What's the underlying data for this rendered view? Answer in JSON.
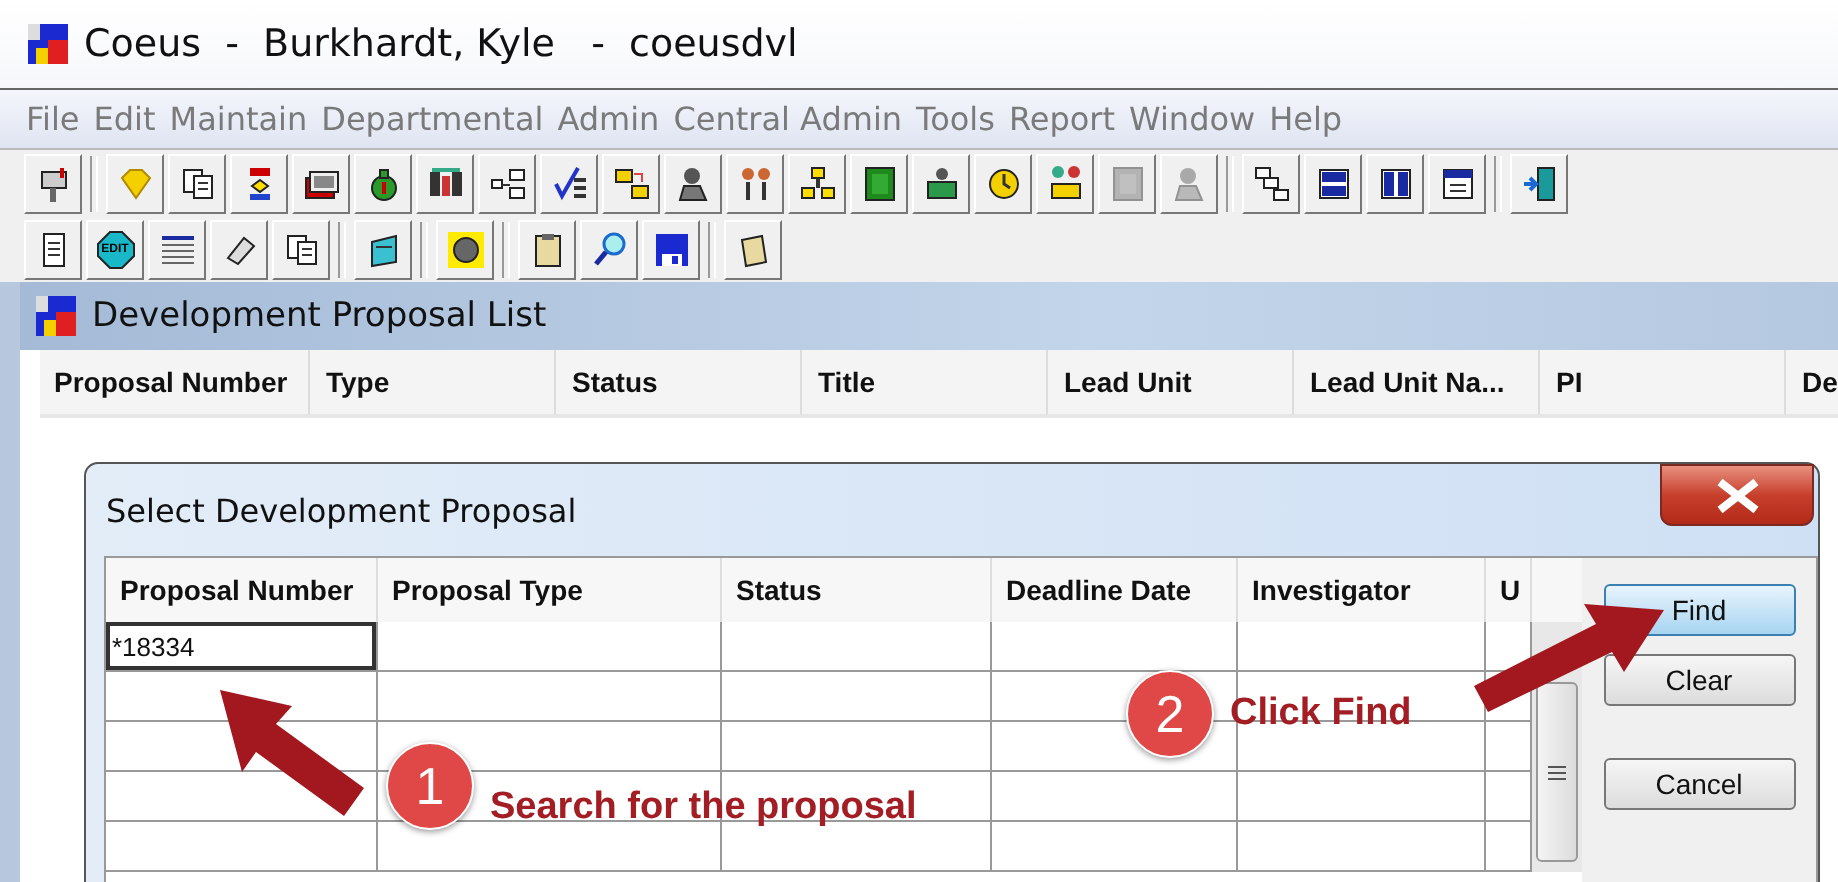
{
  "window": {
    "title": "Coeus  -  Burkhardt, Kyle   -  coeusdvl"
  },
  "menu": [
    "File",
    "Edit",
    "Maintain",
    "Departmental",
    "Admin",
    "Central Admin",
    "Tools",
    "Report",
    "Window",
    "Help"
  ],
  "toolbar_1": [
    {
      "kind": "button",
      "disabled": false
    },
    {
      "kind": "separator"
    },
    {
      "kind": "button",
      "disabled": false
    },
    {
      "kind": "button",
      "disabled": false
    },
    {
      "kind": "button",
      "disabled": false
    },
    {
      "kind": "button",
      "disabled": false
    },
    {
      "kind": "button",
      "disabled": false
    },
    {
      "kind": "button",
      "disabled": false
    },
    {
      "kind": "button",
      "disabled": false
    },
    {
      "kind": "button",
      "disabled": false
    },
    {
      "kind": "button",
      "disabled": false
    },
    {
      "kind": "button",
      "disabled": false
    },
    {
      "kind": "button",
      "disabled": false
    },
    {
      "kind": "button",
      "disabled": false
    },
    {
      "kind": "button",
      "disabled": false
    },
    {
      "kind": "button",
      "disabled": false
    },
    {
      "kind": "button",
      "disabled": false
    },
    {
      "kind": "button",
      "disabled": false
    },
    {
      "kind": "button",
      "disabled": true
    },
    {
      "kind": "button",
      "disabled": true
    },
    {
      "kind": "separator"
    },
    {
      "kind": "button",
      "disabled": false
    },
    {
      "kind": "button",
      "disabled": false
    },
    {
      "kind": "button",
      "disabled": false
    },
    {
      "kind": "button",
      "disabled": false
    },
    {
      "kind": "separator"
    },
    {
      "kind": "button",
      "disabled": false
    }
  ],
  "toolbar_2": [
    {
      "kind": "button",
      "disabled": false
    },
    {
      "kind": "button",
      "disabled": false,
      "label": "EDIT"
    },
    {
      "kind": "button",
      "disabled": false
    },
    {
      "kind": "button",
      "disabled": false
    },
    {
      "kind": "button",
      "disabled": false
    },
    {
      "kind": "separator"
    },
    {
      "kind": "button",
      "disabled": false
    },
    {
      "kind": "separator"
    },
    {
      "kind": "button",
      "disabled": false
    },
    {
      "kind": "separator"
    },
    {
      "kind": "button",
      "disabled": false
    },
    {
      "kind": "button",
      "disabled": false
    },
    {
      "kind": "button",
      "disabled": false
    },
    {
      "kind": "separator"
    },
    {
      "kind": "button",
      "disabled": false
    }
  ],
  "proposal_list": {
    "title": "Development Proposal List",
    "columns": [
      "Proposal Number",
      "Type",
      "Status",
      "Title",
      "Lead Unit",
      "Lead Unit Na...",
      "PI",
      "De"
    ]
  },
  "dialog": {
    "title": "Select Development Proposal",
    "columns": [
      "Proposal Number",
      "Proposal Type",
      "Status",
      "Deadline Date",
      "Investigator",
      "U"
    ],
    "search_value": "*18334",
    "buttons": [
      {
        "label": "Find",
        "default": true
      },
      {
        "label": "Clear",
        "default": false
      },
      {
        "label": "Cancel",
        "default": false
      }
    ]
  },
  "annotations": [
    {
      "number": "1",
      "text": "Search for the proposal"
    },
    {
      "number": "2",
      "text": "Click Find"
    }
  ]
}
